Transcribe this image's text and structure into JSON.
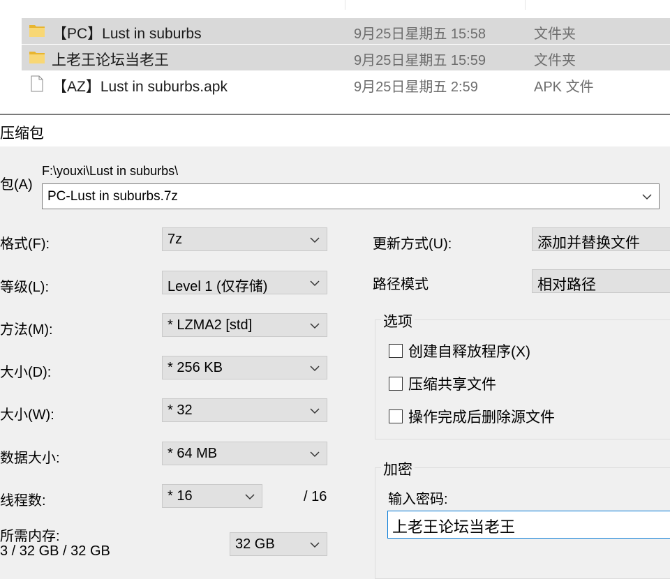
{
  "explorer": {
    "files": [
      {
        "name": "【PC】Lust in suburbs",
        "date": "9月25日星期五 15:58",
        "type": "文件夹",
        "icon": "folder-icon",
        "selected": true
      },
      {
        "name": "上老王论坛当老王",
        "date": "9月25日星期五 15:59",
        "type": "文件夹",
        "icon": "folder-icon",
        "selected": true
      },
      {
        "name": "【AZ】Lust in suburbs.apk",
        "date": "9月25日星期五 2:59",
        "type": "APK 文件",
        "icon": "file-icon",
        "selected": false
      }
    ]
  },
  "dialog": {
    "title": "压缩包",
    "archive": {
      "label": "包(A)",
      "path": "F:\\youxi\\Lust in suburbs\\",
      "filename": "PC-Lust in suburbs.7z"
    },
    "left": {
      "format": {
        "label": "格式(F):",
        "value": "7z"
      },
      "level": {
        "label": "等级(L):",
        "value": "Level 1 (仅存储)"
      },
      "method": {
        "label": "方法(M):",
        "value": "* LZMA2 [std]"
      },
      "dict": {
        "label": "大小(D):",
        "value": "* 256 KB"
      },
      "word": {
        "label": "大小(W):",
        "value": "* 32"
      },
      "solid": {
        "label": "数据大小:",
        "value": "* 64 MB"
      },
      "threads": {
        "label": "线程数:",
        "value": "* 16",
        "max": "/ 16"
      },
      "memory": {
        "label": "所需内存:",
        "detail": "3 / 32 GB / 32 GB",
        "value": "32 GB"
      }
    },
    "right": {
      "update": {
        "label": "更新方式(U):",
        "value": "添加并替换文件"
      },
      "pathmode": {
        "label": "路径模式",
        "value": "相对路径"
      },
      "options": {
        "title": "选项",
        "items": [
          {
            "label": "创建自释放程序(X)",
            "checked": false
          },
          {
            "label": "压缩共享文件",
            "checked": false
          },
          {
            "label": "操作完成后删除源文件",
            "checked": false
          }
        ]
      },
      "encryption": {
        "title": "加密",
        "password_label": "输入密码:",
        "password_value": "上老王论坛当老王"
      }
    }
  }
}
